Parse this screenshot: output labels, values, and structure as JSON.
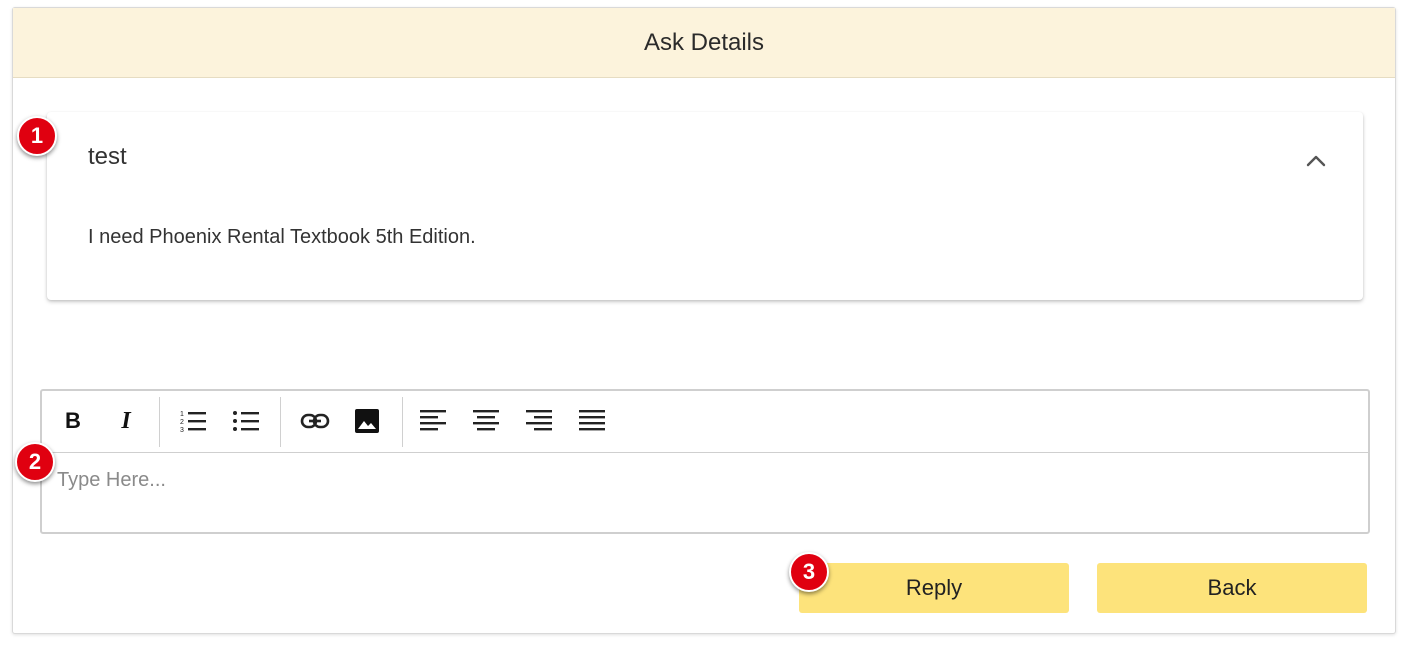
{
  "header": {
    "title": "Ask Details"
  },
  "question": {
    "title": "test",
    "body": "I need Phoenix Rental Textbook 5th Edition.",
    "collapse_icon": "chevron-up-icon"
  },
  "editor": {
    "placeholder": "Type Here...",
    "toolbar": {
      "bold_label": "B",
      "italic_label": "I",
      "icons": [
        "bold-icon",
        "italic-icon",
        "ordered-list-icon",
        "bullet-list-icon",
        "link-icon",
        "image-icon",
        "align-left-icon",
        "align-center-icon",
        "align-right-icon",
        "align-justify-icon"
      ]
    }
  },
  "actions": {
    "reply_label": "Reply",
    "back_label": "Back"
  },
  "markers": {
    "m1": "1",
    "m2": "2",
    "m3": "3"
  },
  "colors": {
    "header_bg": "#fcf3dc",
    "button_bg": "#fde37b",
    "marker": "#e00010"
  }
}
